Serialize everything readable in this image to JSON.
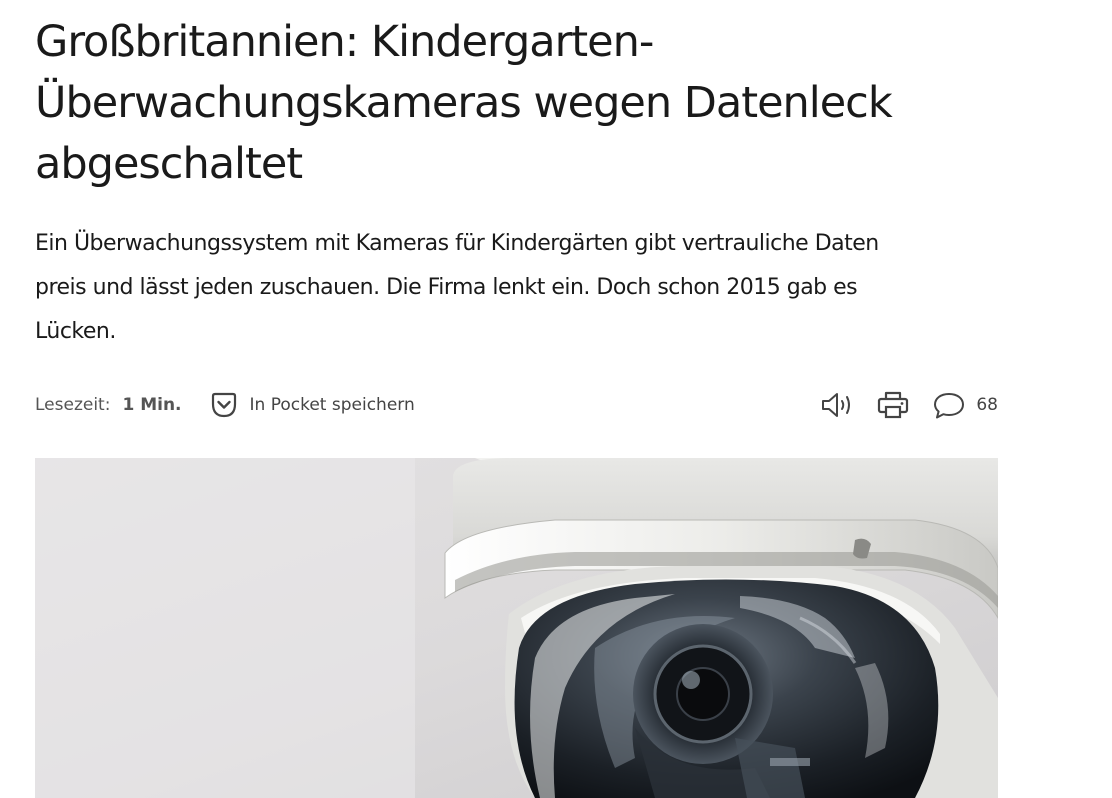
{
  "article": {
    "headline_lines": [
      "Großbritannien: Kindergarten-",
      "Überwachungskameras wegen Datenleck",
      "abgeschaltet"
    ],
    "lead_lines": [
      "Ein Überwachungssystem mit Kameras für Kindergärten gibt vertrauliche Daten",
      "preis und lässt jeden zuschauen. Die Firma lenkt ein. Doch schon 2015 gab es",
      "Lücken."
    ]
  },
  "meta": {
    "reading_time_label": "Lesezeit:",
    "reading_time_value": "1 Min.",
    "pocket_label": "In Pocket speichern",
    "comment_count": "68"
  },
  "icons": {
    "pocket": "pocket-icon",
    "audio": "speaker-icon",
    "print": "printer-icon",
    "comments": "speech-bubble-icon"
  },
  "colors": {
    "text": "#1a1a1a",
    "meta_text": "#555555",
    "icon": "#444444"
  },
  "hero_image": {
    "subject": "security-dome-camera"
  }
}
